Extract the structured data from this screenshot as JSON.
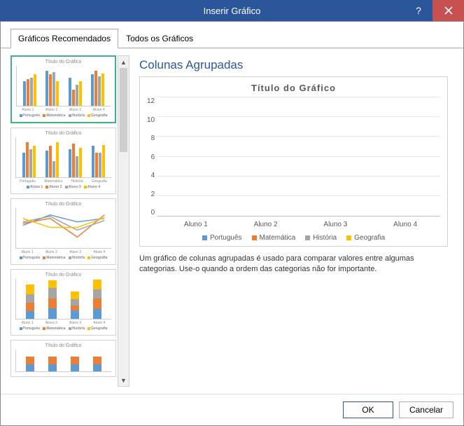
{
  "window": {
    "title": "Inserir Gráfico"
  },
  "tabs": {
    "recommended": "Gráficos Recomendados",
    "all": "Todos os Gráficos"
  },
  "preview": {
    "heading": "Colunas Agrupadas",
    "chart_title": "Título do Gráfico",
    "description": "Um gráfico de colunas agrupadas é usado para comparar valores entre algumas categorias. Use-o quando a ordem das categorias não for importante."
  },
  "colors": {
    "portugues": "#5b9bd5",
    "matematica": "#ed7d31",
    "historia": "#a5a5a5",
    "geografia": "#ffc000"
  },
  "chart_data": {
    "type": "bar",
    "title": "Título do Gráfico",
    "xlabel": "",
    "ylabel": "",
    "ylim": [
      0,
      12
    ],
    "yticks": [
      0,
      2,
      4,
      6,
      8,
      10,
      12
    ],
    "categories": [
      "Aluno 1",
      "Aluno 2",
      "Aluno 3",
      "Aluno 4"
    ],
    "series": [
      {
        "name": "Português",
        "color": "#5b9bd5",
        "values": [
          7.0,
          10.0,
          8.0,
          9.0
        ]
      },
      {
        "name": "Matemática",
        "color": "#ed7d31",
        "values": [
          7.6,
          9.0,
          4.6,
          10.0
        ]
      },
      {
        "name": "História",
        "color": "#a5a5a5",
        "values": [
          8.0,
          9.7,
          6.1,
          8.4
        ]
      },
      {
        "name": "Geografia",
        "color": "#ffc000",
        "values": [
          9.0,
          7.0,
          7.0,
          9.2
        ]
      }
    ]
  },
  "thumbs": {
    "title": "Título do Gráfico",
    "xlabels_students": [
      "Aluno 1",
      "Aluno 2",
      "Aluno 3",
      "Aluno 4"
    ],
    "xlabels_subjects": [
      "Português",
      "Matemática",
      "História",
      "Geografia"
    ],
    "legend_subjects": [
      "Português",
      "Matemática",
      "História",
      "Geografia"
    ],
    "legend_students": [
      "Aluno 1",
      "Aluno 2",
      "Aluno 3",
      "Aluno 4"
    ]
  },
  "footer": {
    "ok": "OK",
    "cancel": "Cancelar"
  }
}
